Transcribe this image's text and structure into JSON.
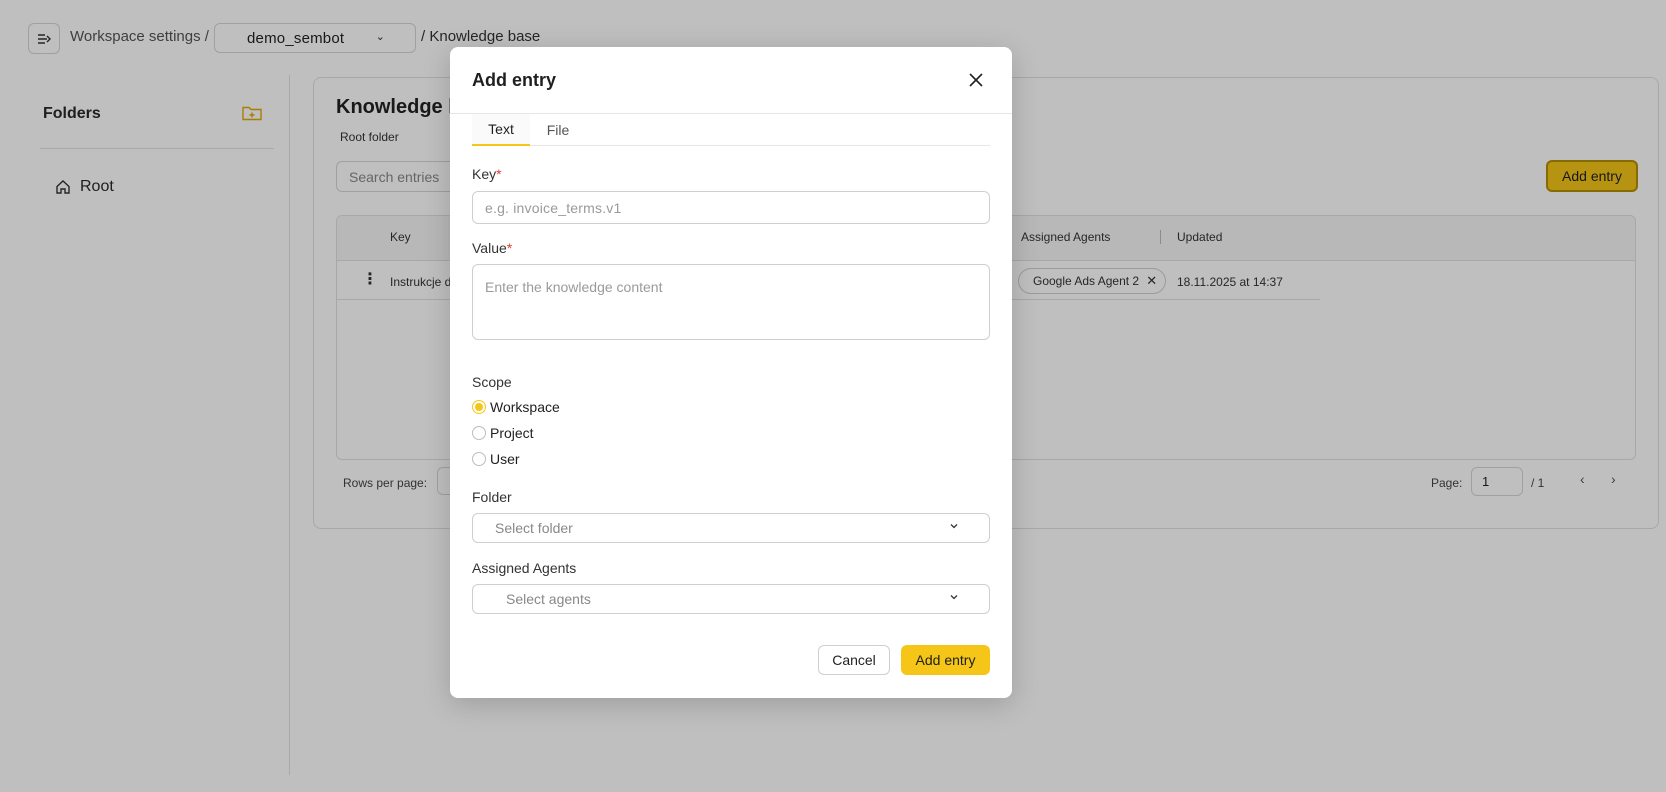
{
  "breadcrumb": {
    "workspace_settings": "Workspace settings /",
    "workspace": "demo_sembot",
    "separator": "/",
    "current": "Knowledge base"
  },
  "sidebar": {
    "title": "Folders",
    "new_folder_icon": "folder-plus-icon",
    "root_label": "Root"
  },
  "main": {
    "title": "Knowledge b",
    "subtitle": "Root folder",
    "search_placeholder": "Search entries",
    "add_entry_label": "Add entry",
    "table": {
      "columns": [
        "Key",
        "Assigned Agents",
        "Updated"
      ],
      "rows": [
        {
          "key": "Instrukcje d",
          "agent": "Google Ads Agent 2",
          "updated": "18.11.2025 at 14:37"
        }
      ]
    },
    "pager": {
      "rows_per_page_label": "Rows per page:",
      "page_label": "Page:",
      "page_value": "1",
      "page_total": "/ 1"
    }
  },
  "modal": {
    "title": "Add entry",
    "tabs": [
      "Text",
      "File"
    ],
    "active_tab": "Text",
    "key_label": "Key",
    "key_placeholder": "e.g. invoice_terms.v1",
    "value_label": "Value",
    "value_placeholder": "Enter the knowledge content",
    "required_mark": "*",
    "scope_label": "Scope",
    "scope_options": [
      "Workspace",
      "Project",
      "User"
    ],
    "scope_selected": "Workspace",
    "folder_label": "Folder",
    "folder_placeholder": "Select folder",
    "agents_label": "Assigned Agents",
    "agents_placeholder": "Select agents",
    "cancel_label": "Cancel",
    "submit_label": "Add entry"
  },
  "colors": {
    "accent": "#f5c518",
    "required": "#e53935",
    "overlay": "rgba(0,0,0,0.25)"
  }
}
